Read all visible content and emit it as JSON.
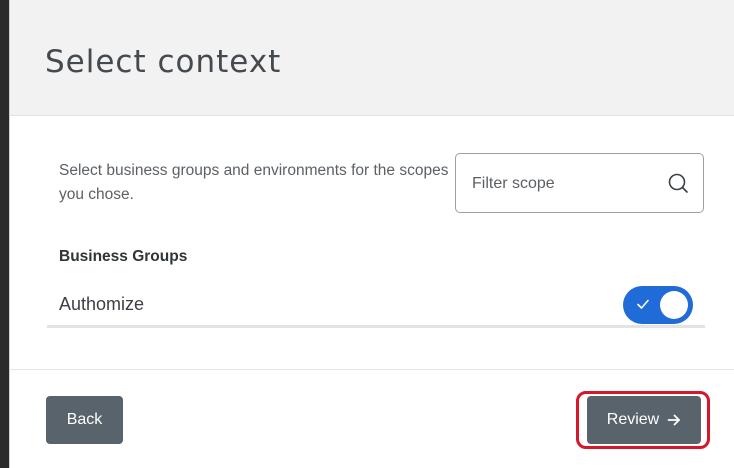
{
  "dialog": {
    "title": "Select context"
  },
  "body": {
    "description": "Select business groups and environments for the scopes you chose.",
    "filter": {
      "placeholder": "Filter scope",
      "icon": "search-icon"
    },
    "section_heading": "Business Groups",
    "groups": [
      {
        "label": "Authomize",
        "enabled": true
      }
    ]
  },
  "footer": {
    "back_label": "Back",
    "review_label": "Review",
    "review_icon": "arrow-right-icon"
  },
  "colors": {
    "toggle_on": "#1f6bd8",
    "button_bg": "#58636b",
    "highlight": "#d6172a",
    "header_bg": "#f2f2f2"
  }
}
